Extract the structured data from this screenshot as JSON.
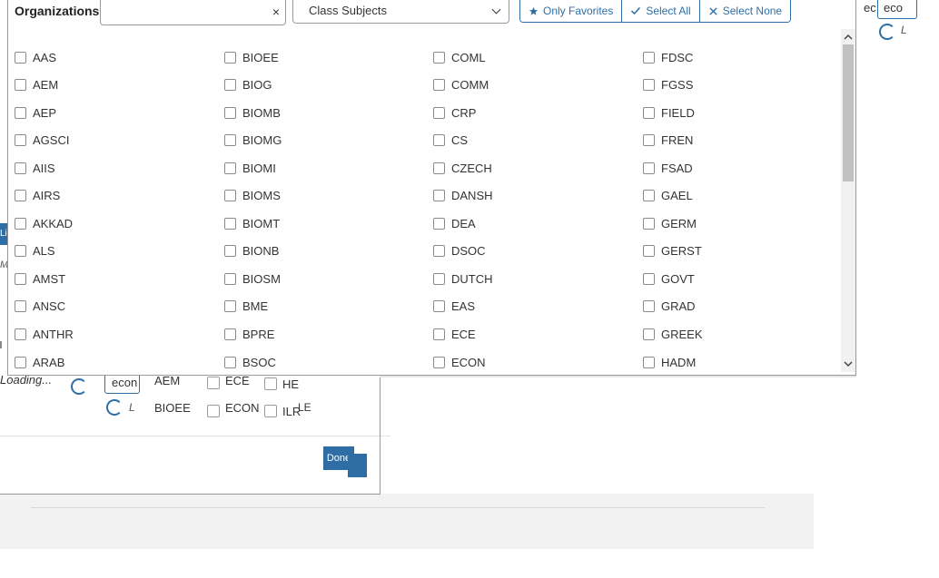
{
  "modal": {
    "title": "Organizations",
    "filter": {
      "value": "",
      "clear_glyph": "×"
    },
    "select": {
      "selected": "Class Subjects"
    },
    "buttons": {
      "only_favorites": "Only Favorites",
      "select_all": "Select All",
      "select_none": "Select None"
    },
    "columns": [
      [
        "AAS",
        "AEM",
        "AEP",
        "AGSCI",
        "AIIS",
        "AIRS",
        "AKKAD",
        "ALS",
        "AMST",
        "ANSC",
        "ANTHR",
        "ARAB"
      ],
      [
        "BIOEE",
        "BIOG",
        "BIOMB",
        "BIOMG",
        "BIOMI",
        "BIOMS",
        "BIOMT",
        "BIONB",
        "BIOSM",
        "BME",
        "BPRE",
        "BSOC"
      ],
      [
        "COML",
        "COMM",
        "CRP",
        "CS",
        "CZECH",
        "DANSH",
        "DEA",
        "DSOC",
        "DUTCH",
        "EAS",
        "ECE",
        "ECON"
      ],
      [
        "FDSC",
        "FGSS",
        "FIELD",
        "FREN",
        "FSAD",
        "GAEL",
        "GERM",
        "GERST",
        "GOVT",
        "GRAD",
        "GREEK",
        "HADM"
      ]
    ],
    "icons": {
      "star": "star-icon",
      "check": "check-icon",
      "close": "close-icon",
      "chevron": "chevron-down-icon"
    }
  },
  "background": {
    "loading_text": "Loading...",
    "search_value": "econ",
    "results_col1": [
      "AEM",
      "BIOEE"
    ],
    "results_col2": [
      "ECE",
      "ECON"
    ],
    "results_col3": [
      "HE",
      "ILR"
    ],
    "fragment_le": "LE",
    "done_button": "Done",
    "right_input_value": "eco",
    "right_text": "ec",
    "side_tab": "Li",
    "side_text": "Ma"
  },
  "colors": {
    "accent": "#2f6ea5",
    "border": "#9a9a9a",
    "scroll_thumb": "#c1c1c1"
  }
}
